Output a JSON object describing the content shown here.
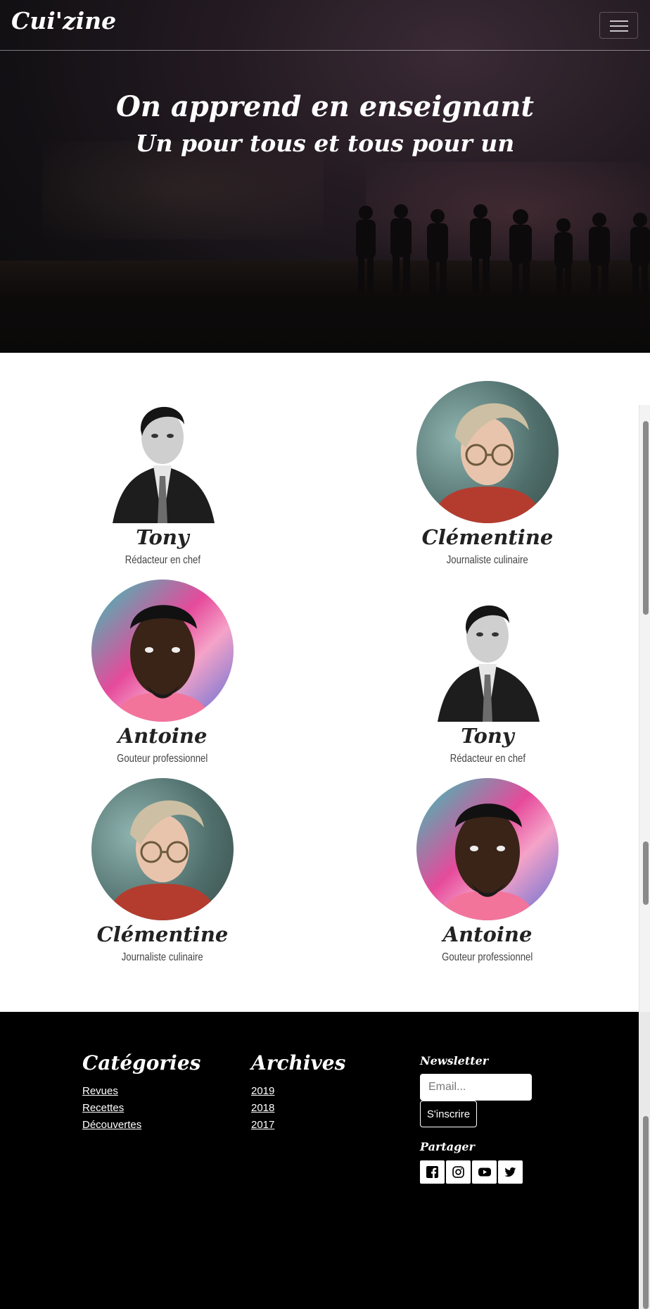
{
  "brand": "Cui'zine",
  "nav": {
    "menu_icon": "hamburger-menu-icon"
  },
  "hero": {
    "title": "On apprend en enseignant",
    "subtitle": "Un pour tous et tous pour un"
  },
  "team": [
    {
      "name": "Tony",
      "role": "Rédacteur en chef",
      "photo": "portrait-man-suit"
    },
    {
      "name": "Clémentine",
      "role": "Journaliste culinaire",
      "photo": "portrait-woman-glasses"
    },
    {
      "name": "Antoine",
      "role": "Gouteur professionnel",
      "photo": "portrait-man-colorful"
    },
    {
      "name": "Tony",
      "role": "Rédacteur en chef",
      "photo": "portrait-man-suit"
    },
    {
      "name": "Clémentine",
      "role": "Journaliste culinaire",
      "photo": "portrait-woman-glasses"
    },
    {
      "name": "Antoine",
      "role": "Gouteur professionnel",
      "photo": "portrait-man-colorful"
    }
  ],
  "footer": {
    "categories": {
      "title": "Catégories",
      "links": [
        "Revues",
        "Recettes",
        "Découvertes"
      ]
    },
    "archives": {
      "title": "Archives",
      "links": [
        "2019",
        "2018",
        "2017"
      ]
    },
    "newsletter": {
      "title": "Newsletter",
      "email_placeholder": "Email...",
      "button": "S'inscrire"
    },
    "share": {
      "title": "Partager",
      "icons": [
        "facebook-icon",
        "instagram-icon",
        "youtube-icon",
        "twitter-icon"
      ]
    }
  },
  "colors": {
    "footer_bg": "#000000",
    "hero_bg": "#1a1416",
    "text_dark": "#222222"
  }
}
